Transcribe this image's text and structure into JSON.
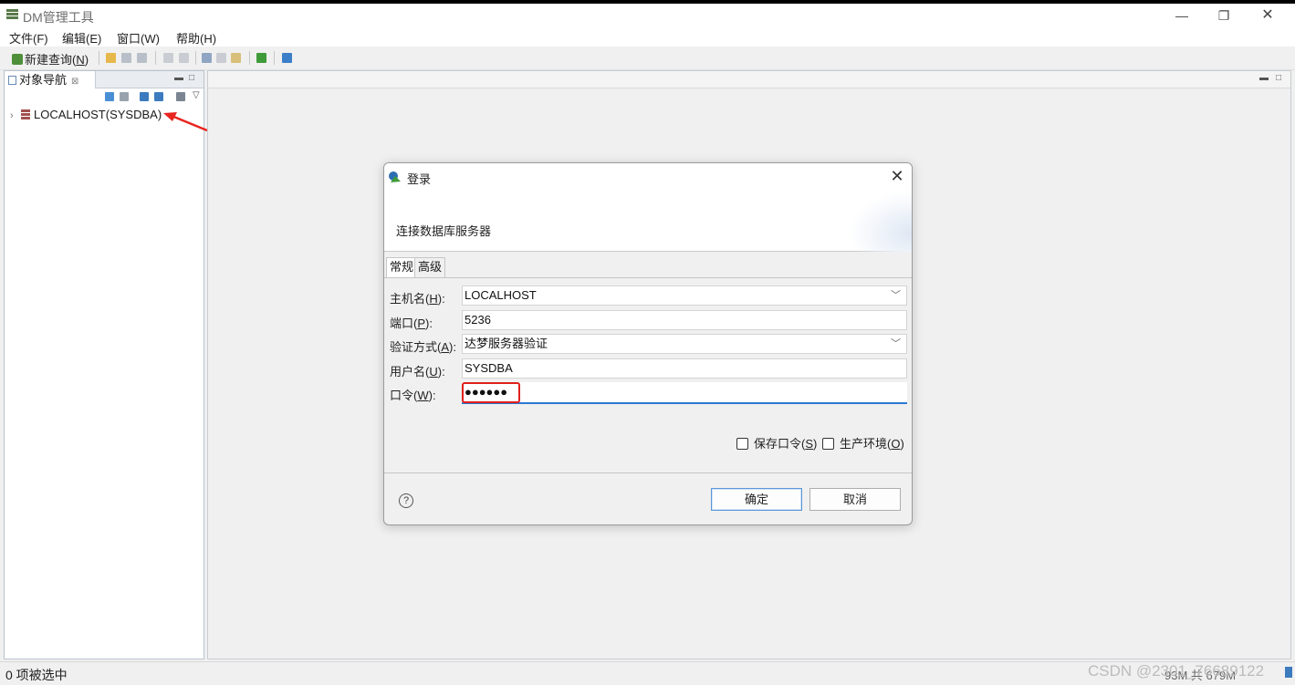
{
  "window": {
    "title": "DM管理工具",
    "minimize": "—",
    "maximize": "❐",
    "close": "✕"
  },
  "menu": [
    "文件(F)",
    "编辑(E)",
    "窗口(W)",
    "帮助(H)"
  ],
  "toolbar": {
    "new_query_prefix": "新建查询(",
    "new_query_key": "N",
    "new_query_suffix": ")"
  },
  "navigator": {
    "tab_label": "对象导航",
    "tab_close": "⊠",
    "tree": [
      {
        "label": "LOCALHOST(SYSDBA)",
        "icon": "database-icon",
        "expanded": false
      }
    ]
  },
  "dialog": {
    "title": "登录",
    "header": "连接数据库服务器",
    "tabs": [
      "常规",
      "高级"
    ],
    "active_tab": "常规",
    "fields": {
      "host": {
        "label_pre": "主机名(",
        "key": "H",
        "label_post": "):",
        "value": "LOCALHOST"
      },
      "port": {
        "label_pre": "端口(",
        "key": "P",
        "label_post": "):",
        "value": "5236"
      },
      "auth": {
        "label_pre": "验证方式(",
        "key": "A",
        "label_post": "):",
        "value": "达梦服务器验证"
      },
      "user": {
        "label_pre": "用户名(",
        "key": "U",
        "label_post": "):",
        "value": "SYSDBA"
      },
      "password": {
        "label_pre": "口令(",
        "key": "W",
        "label_post": "):",
        "value": "●●●●●●"
      }
    },
    "save_password": {
      "label_pre": "保存口令(",
      "key": "S",
      "label_post": ")",
      "checked": false
    },
    "production_env": {
      "label_pre": "生产环境(",
      "key": "O",
      "label_post": ")",
      "checked": false
    },
    "help": "?",
    "ok_label": "确定",
    "cancel_label": "取消",
    "close": "✕"
  },
  "status": {
    "selection": "0 项被选中",
    "memory": "93M 共 679M",
    "watermark": "CSDN @2301_76689122"
  },
  "colors": {
    "highlight_box": "#e0201b",
    "focus_underline": "#2b79d3",
    "annotation_arrow": "#e8251f"
  }
}
